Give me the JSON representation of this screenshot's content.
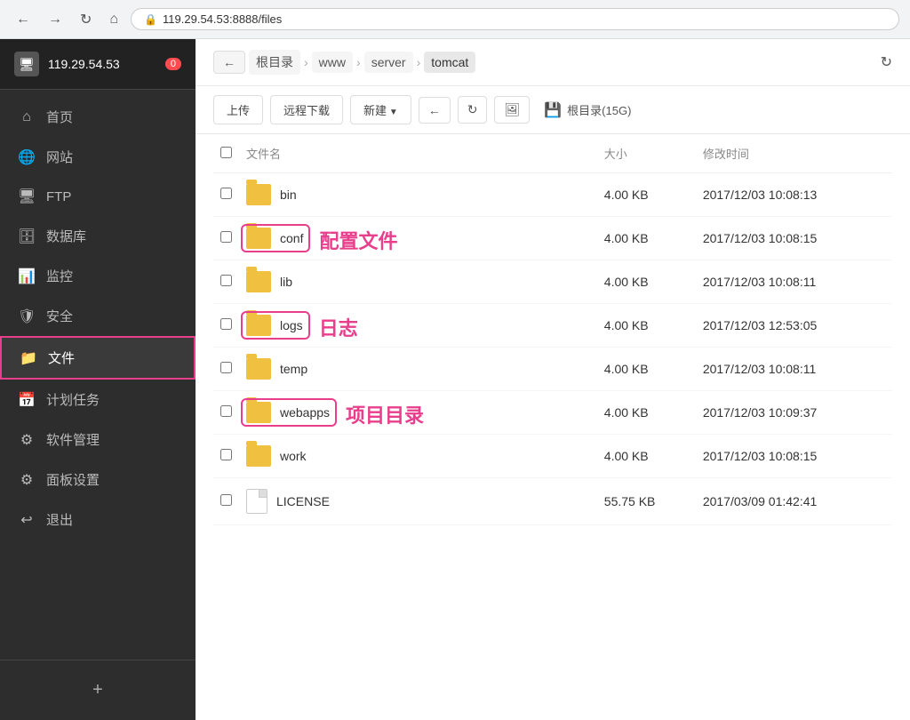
{
  "browser": {
    "url": "119.29.54.53:8888/files",
    "back_label": "←",
    "forward_label": "→",
    "refresh_label": "↻",
    "home_label": "⌂"
  },
  "sidebar": {
    "server_ip": "119.29.54.53",
    "notification_count": "0",
    "items": [
      {
        "id": "home",
        "icon": "⌂",
        "label": "首页"
      },
      {
        "id": "website",
        "icon": "🌐",
        "label": "网站"
      },
      {
        "id": "ftp",
        "icon": "🖥",
        "label": "FTP"
      },
      {
        "id": "database",
        "icon": "🗄",
        "label": "数据库"
      },
      {
        "id": "monitor",
        "icon": "📊",
        "label": "监控"
      },
      {
        "id": "security",
        "icon": "🛡",
        "label": "安全"
      },
      {
        "id": "files",
        "icon": "📁",
        "label": "文件",
        "active": true
      },
      {
        "id": "scheduled",
        "icon": "📅",
        "label": "计划任务"
      },
      {
        "id": "software",
        "icon": "⚙",
        "label": "软件管理"
      },
      {
        "id": "panel",
        "icon": "⚙",
        "label": "面板设置"
      },
      {
        "id": "logout",
        "icon": "↩",
        "label": "退出"
      }
    ],
    "add_label": "+"
  },
  "breadcrumb": {
    "back_label": "←",
    "items": [
      "根目录",
      "www",
      "server",
      "tomcat"
    ],
    "refresh_label": "↻"
  },
  "toolbar": {
    "upload_label": "上传",
    "remote_download_label": "远程下载",
    "new_label": "新建",
    "back_label": "←",
    "refresh_label": "↻",
    "disk_icon": "💾",
    "disk_info": "根目录(15G)"
  },
  "file_table": {
    "columns": [
      "文件名",
      "大小",
      "修改时间"
    ],
    "rows": [
      {
        "name": "bin",
        "type": "folder",
        "size": "4.00 KB",
        "modified": "2017/12/03 10:08:13",
        "highlighted": false,
        "annotation": ""
      },
      {
        "name": "conf",
        "type": "folder",
        "size": "4.00 KB",
        "modified": "2017/12/03 10:08:15",
        "highlighted": true,
        "annotation": "配置文件"
      },
      {
        "name": "lib",
        "type": "folder",
        "size": "4.00 KB",
        "modified": "2017/12/03 10:08:11",
        "highlighted": false,
        "annotation": ""
      },
      {
        "name": "logs",
        "type": "folder",
        "size": "4.00 KB",
        "modified": "2017/12/03 12:53:05",
        "highlighted": true,
        "annotation": "日志"
      },
      {
        "name": "temp",
        "type": "folder",
        "size": "4.00 KB",
        "modified": "2017/12/03 10:08:11",
        "highlighted": false,
        "annotation": ""
      },
      {
        "name": "webapps",
        "type": "folder",
        "size": "4.00 KB",
        "modified": "2017/12/03 10:09:37",
        "highlighted": true,
        "annotation": "项目目录"
      },
      {
        "name": "work",
        "type": "folder",
        "size": "4.00 KB",
        "modified": "2017/12/03 10:08:15",
        "highlighted": false,
        "annotation": ""
      },
      {
        "name": "LICENSE",
        "type": "file",
        "size": "55.75 KB",
        "modified": "2017/03/09 01:42:41",
        "highlighted": false,
        "annotation": ""
      }
    ]
  }
}
